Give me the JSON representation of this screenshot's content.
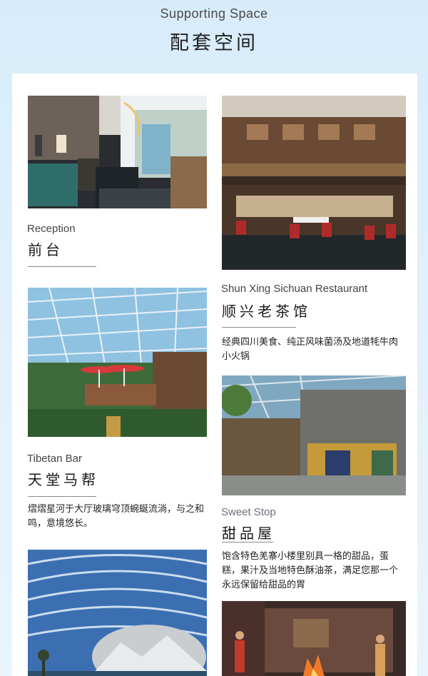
{
  "header": {
    "title_en": "Supporting Space",
    "title_zh": "配套空间"
  },
  "items": [
    {
      "en": "Reception",
      "zh": "前台",
      "description": "",
      "image": "reception-lobby-photo"
    },
    {
      "en": "Shun Xing Sichuan Restaurant",
      "zh": "顺兴老茶馆",
      "description": "经典四川美食、纯正风味菌汤及地道牦牛肉小火锅",
      "image": "sichuan-restaurant-photo"
    },
    {
      "en": "Tibetan Bar",
      "zh": "天堂马帮",
      "description": "熠熠星河于大厅玻璃穹顶蜿蜒流淌，与之和鸣，意境悠长。",
      "image": "tibetan-bar-atrium-photo"
    },
    {
      "en": "Sweet Stop",
      "zh": "甜品屋",
      "description": "饱含特色羌寨小楼里别具一格的甜品，蛋糕，果汁及当地特色酥油茶，满足您那一个永远保留给甜品的胃",
      "image": "sweet-stop-photo"
    },
    {
      "en": "",
      "zh": "",
      "description": "",
      "image": "glass-dome-pool-photo"
    },
    {
      "en": "",
      "zh": "",
      "description": "",
      "image": "tibetan-performance-photo"
    }
  ]
}
